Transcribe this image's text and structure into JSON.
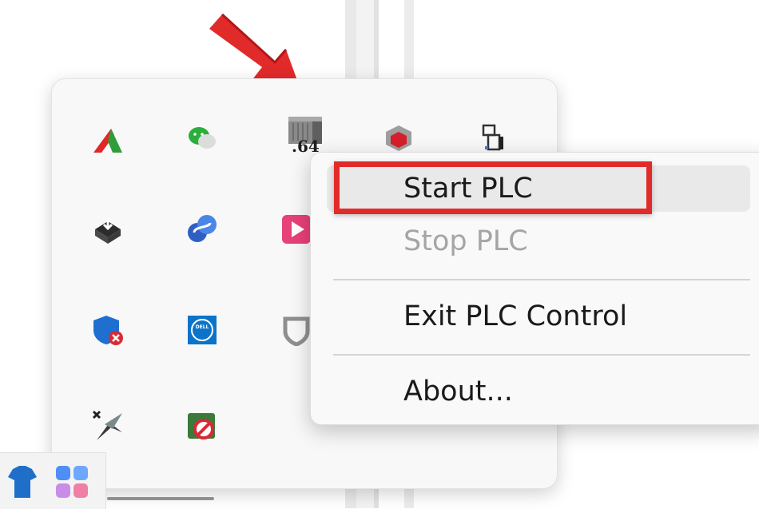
{
  "tray": {
    "icons": [
      {
        "name": "red-green-peak-icon"
      },
      {
        "name": "wechat-icon"
      },
      {
        "name": "plc-x64-icon",
        "label": ".64"
      },
      {
        "name": "red-hexagon-cube-icon"
      },
      {
        "name": "device-panel-icon"
      },
      {
        "name": "box-download-icon"
      },
      {
        "name": "blue-link-icon"
      },
      {
        "name": "pink-play-icon"
      },
      {
        "name": "shield-error-icon"
      },
      {
        "name": "dell-icon",
        "label": "DELL"
      },
      {
        "name": "grey-shield-icon"
      },
      {
        "name": "x-sword-icon"
      },
      {
        "name": "green-no-symbol-icon"
      }
    ]
  },
  "context_menu": {
    "items": [
      {
        "label": "Start PLC",
        "state": "highlighted"
      },
      {
        "label": "Stop PLC",
        "state": "disabled"
      },
      {
        "label": "Exit PLC Control",
        "state": "enabled"
      },
      {
        "label": "About...",
        "state": "enabled"
      }
    ]
  },
  "annotations": {
    "arrow_color": "#e12a2a",
    "highlight_color": "#e12a2a"
  },
  "taskbar": {
    "icons": [
      {
        "name": "blue-shirt-icon"
      },
      {
        "name": "start-grid-icon"
      }
    ]
  }
}
